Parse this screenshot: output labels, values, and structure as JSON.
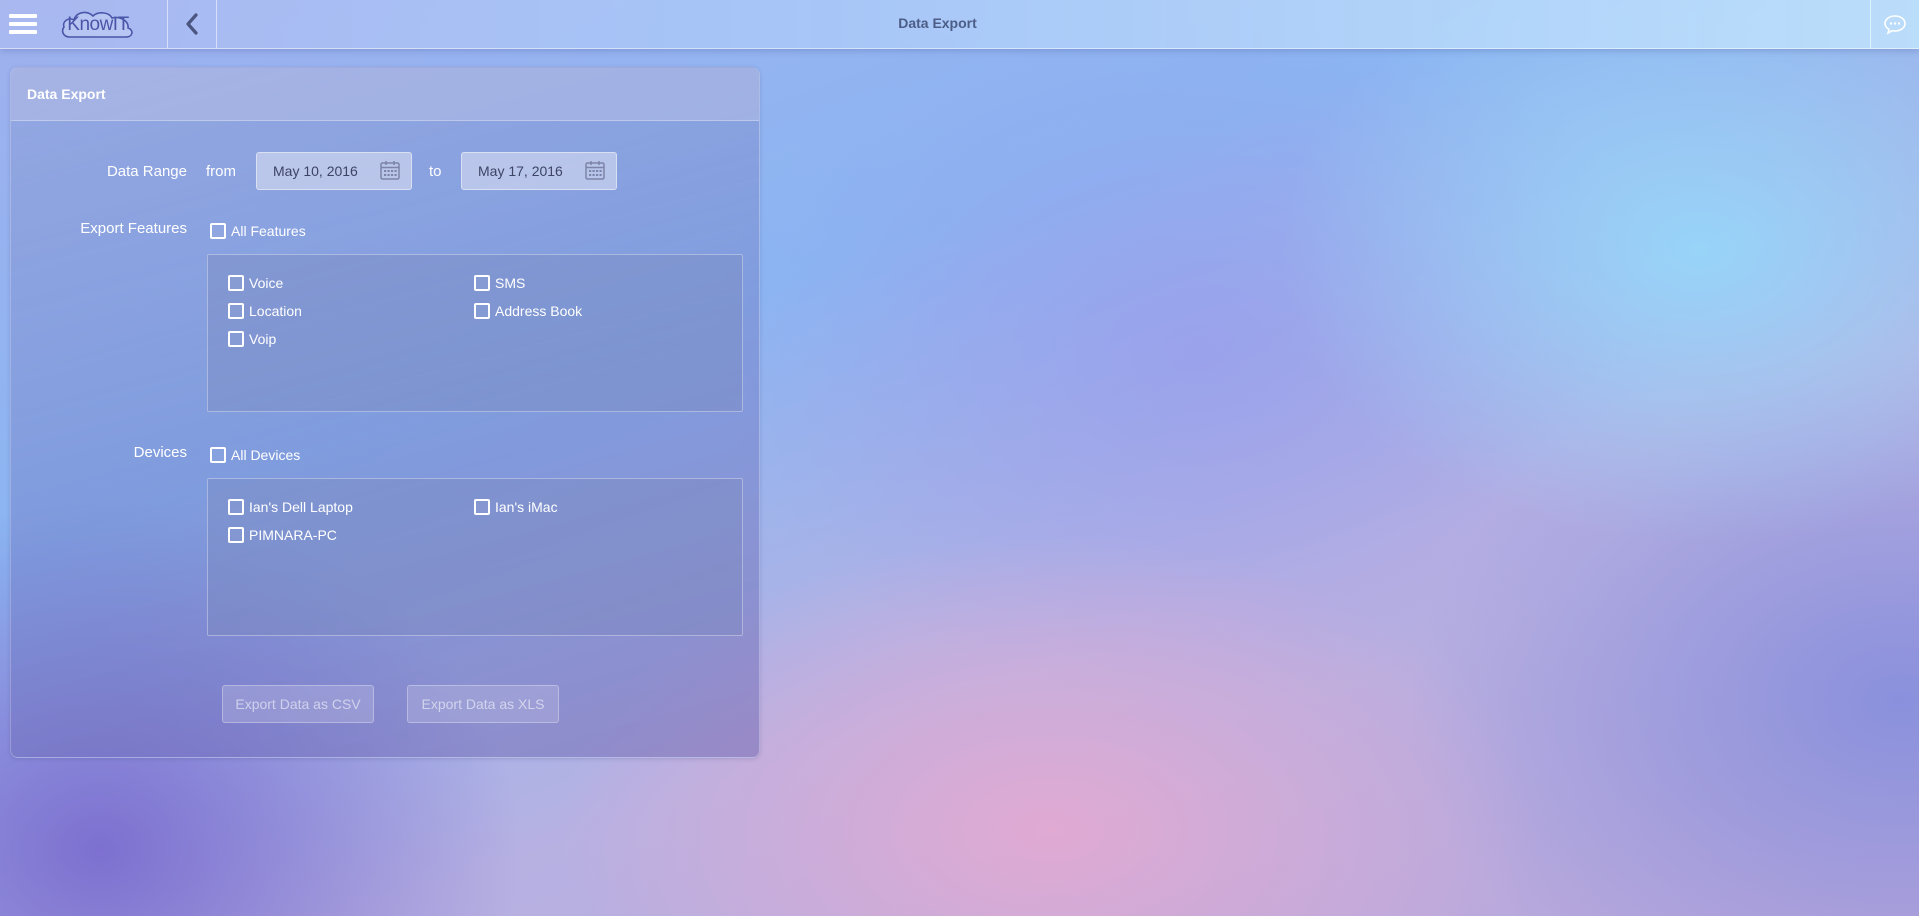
{
  "app": {
    "logo_text": "KnowIT",
    "page_title": "Data Export"
  },
  "panel": {
    "title": "Data Export"
  },
  "date_range": {
    "label": "Data Range",
    "from_label": "from",
    "to_label": "to",
    "from_value": "May 10, 2016",
    "to_value": "May 17, 2016"
  },
  "features": {
    "label": "Export Features",
    "all_label": "All Features",
    "items": [
      {
        "label": "Voice",
        "checked": false
      },
      {
        "label": "SMS",
        "checked": false
      },
      {
        "label": "Location",
        "checked": false
      },
      {
        "label": "Address Book",
        "checked": false
      },
      {
        "label": "Voip",
        "checked": false
      }
    ]
  },
  "devices": {
    "label": "Devices",
    "all_label": "All Devices",
    "items": [
      {
        "label": "Ian's Dell Laptop",
        "checked": false
      },
      {
        "label": "Ian's iMac",
        "checked": false
      },
      {
        "label": "PIMNARA-PC",
        "checked": false
      }
    ]
  },
  "buttons": {
    "csv": "Export Data as CSV",
    "xls": "Export Data as XLS"
  },
  "icons": {
    "menu": "hamburger-menu-icon",
    "back": "chevron-left-icon",
    "chat": "chat-bubble-icon",
    "calendar": "calendar-icon"
  },
  "colors": {
    "title_text": "#4c5d86",
    "logo": "#4a55a8",
    "date_text": "#3d4466"
  }
}
